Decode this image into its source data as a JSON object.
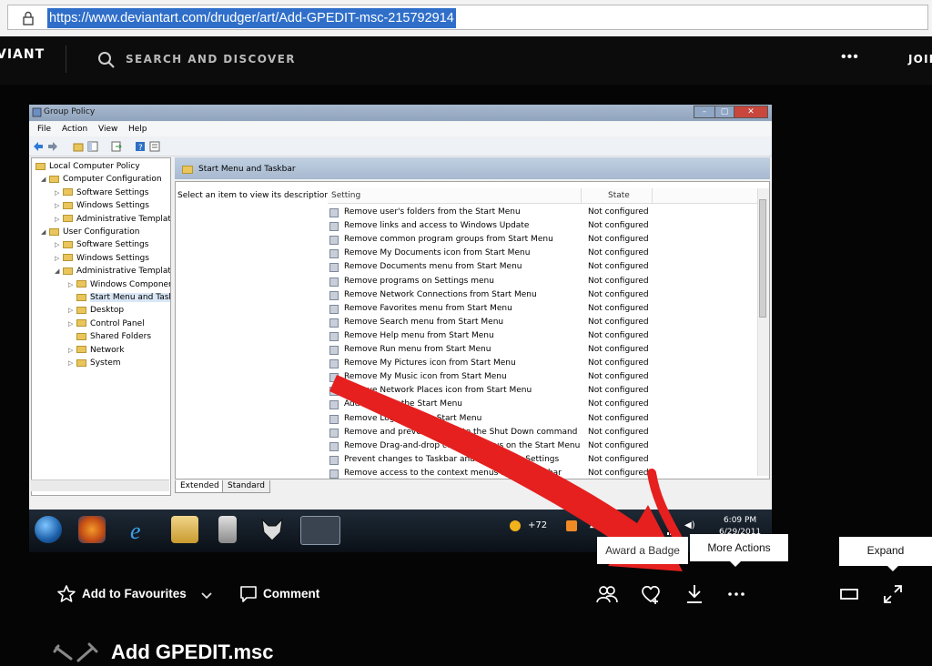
{
  "browser": {
    "url": "https://www.deviantart.com/drudger/art/Add-GPEDIT-msc-215792914",
    "lock_icon": "lock-icon"
  },
  "site_header": {
    "logo_text": "VIANT",
    "search_label": "SEARCH AND DISCOVER",
    "more_label": "•••",
    "join_label": "JOIN"
  },
  "screenshot": {
    "window_title": "Group Policy",
    "menu": [
      "File",
      "Action",
      "View",
      "Help"
    ],
    "tree": [
      {
        "label": "Local Computer Policy",
        "indent": 0,
        "expander": ""
      },
      {
        "label": "Computer Configuration",
        "indent": 1,
        "expander": "◢"
      },
      {
        "label": "Software Settings",
        "indent": 2,
        "expander": "▷"
      },
      {
        "label": "Windows Settings",
        "indent": 2,
        "expander": "▷"
      },
      {
        "label": "Administrative Template",
        "indent": 2,
        "expander": "▷"
      },
      {
        "label": "User Configuration",
        "indent": 1,
        "expander": "◢"
      },
      {
        "label": "Software Settings",
        "indent": 2,
        "expander": "▷"
      },
      {
        "label": "Windows Settings",
        "indent": 2,
        "expander": "▷"
      },
      {
        "label": "Administrative Template",
        "indent": 2,
        "expander": "◢"
      },
      {
        "label": "Windows Componen",
        "indent": 3,
        "expander": "▷"
      },
      {
        "label": "Start Menu and Task",
        "indent": 3,
        "expander": "",
        "selected": true
      },
      {
        "label": "Desktop",
        "indent": 3,
        "expander": "▷"
      },
      {
        "label": "Control Panel",
        "indent": 3,
        "expander": "▷"
      },
      {
        "label": "Shared Folders",
        "indent": 3,
        "expander": ""
      },
      {
        "label": "Network",
        "indent": 3,
        "expander": "▷"
      },
      {
        "label": "System",
        "indent": 3,
        "expander": "▷"
      }
    ],
    "pane_title": "Start Menu and Taskbar",
    "description": "Select an item to view its description.",
    "columns": {
      "setting": "Setting",
      "state": "State"
    },
    "settings": [
      {
        "name": "Remove user's folders from the Start Menu",
        "state": "Not configured"
      },
      {
        "name": "Remove links and access to Windows Update",
        "state": "Not configured"
      },
      {
        "name": "Remove common program groups from Start Menu",
        "state": "Not configured"
      },
      {
        "name": "Remove My Documents icon from Start Menu",
        "state": "Not configured"
      },
      {
        "name": "Remove Documents menu from Start Menu",
        "state": "Not configured"
      },
      {
        "name": "Remove programs on Settings menu",
        "state": "Not configured"
      },
      {
        "name": "Remove Network Connections from Start Menu",
        "state": "Not configured"
      },
      {
        "name": "Remove Favorites menu from Start Menu",
        "state": "Not configured"
      },
      {
        "name": "Remove Search menu from Start Menu",
        "state": "Not configured"
      },
      {
        "name": "Remove Help menu from Start Menu",
        "state": "Not configured"
      },
      {
        "name": "Remove Run menu from Start Menu",
        "state": "Not configured"
      },
      {
        "name": "Remove My Pictures icon from Start Menu",
        "state": "Not configured"
      },
      {
        "name": "Remove My Music icon from Start Menu",
        "state": "Not configured"
      },
      {
        "name": "Remove Network Places icon from Start Menu",
        "state": "Not configured"
      },
      {
        "name": "Add Logoff to the Start Menu",
        "state": "Not configured"
      },
      {
        "name": "Remove Logoff on the Start Menu",
        "state": "Not configured"
      },
      {
        "name": "Remove and prevent access to the Shut Down command",
        "state": "Not configured"
      },
      {
        "name": "Remove Drag-and-drop context menus on the Start Menu",
        "state": "Not configured"
      },
      {
        "name": "Prevent changes to Taskbar and Start Menu Settings",
        "state": "Not configured"
      },
      {
        "name": "Remove access to the context menus for the taskbar",
        "state": "Not configured"
      }
    ],
    "tabs": [
      "Extended",
      "Standard"
    ],
    "tray": {
      "temp": "+72",
      "time": "6:09 PM",
      "date": "6/29/2011"
    }
  },
  "tooltips": {
    "award": "Award a Badge",
    "more_actions": "More Actions",
    "expand": "Expand"
  },
  "actions": {
    "add_to_favourites": "Add to Favourites",
    "comment": "Comment"
  },
  "deviation": {
    "title": "Add GPEDIT.msc"
  },
  "colors": {
    "page_bg": "#060606",
    "url_highlight": "#2f6fc9",
    "arrow_red": "#e5201f"
  }
}
